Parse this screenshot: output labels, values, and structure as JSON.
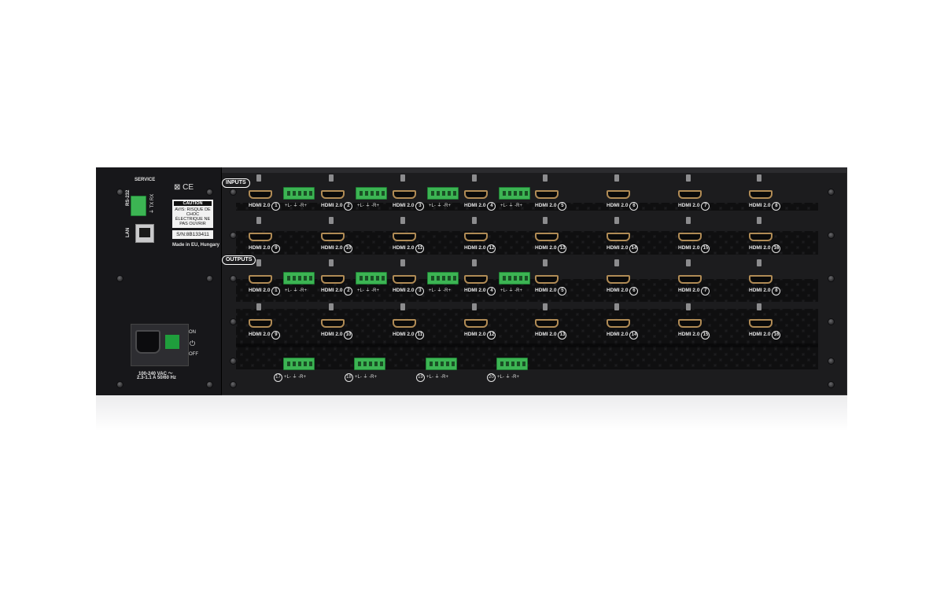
{
  "panel": {
    "service_label": "SERVICE",
    "rs232_label": "RS-232",
    "rs232_pins": "⏚ TX RX",
    "lan_label": "LAN",
    "caution_title": "CAUTION",
    "caution_text": "AVIS: RISQUE DE CHOC ÉLECTRIQUE NE PAS OUVRIR",
    "serial": "S/N:8B133411",
    "made_in": "Made in EU, Hungary",
    "ce_mark": "⊠ CE",
    "on_label": "ON",
    "off_label": "OFF",
    "power_icon": "⏻",
    "power_spec_line1": "100-240 VAC ～",
    "power_spec_line2": "2.3-1.1 A  50/60 Hz"
  },
  "sections": {
    "inputs_label": "INPUTS",
    "outputs_label": "OUTPUTS"
  },
  "ports": {
    "hdmi_label": "HDMI 2.0",
    "input_numbers": [
      "1",
      "2",
      "3",
      "4",
      "5",
      "6",
      "7",
      "8",
      "9",
      "10",
      "11",
      "12",
      "13",
      "14",
      "15",
      "16"
    ],
    "output_numbers": [
      "1",
      "2",
      "3",
      "4",
      "5",
      "6",
      "7",
      "8",
      "9",
      "10",
      "11",
      "12",
      "13",
      "14",
      "15",
      "16"
    ],
    "audio_in_symbols": "+L- ⏚ -R+",
    "audio_out_symbols": "+L- ⏚ -R+",
    "extra_audio_numbers": [
      "17",
      "18",
      "19",
      "20"
    ]
  },
  "colors": {
    "chassis": "#1c1c1e",
    "terminal_green": "#3cb453",
    "hdmi_gold": "#b08b55"
  }
}
